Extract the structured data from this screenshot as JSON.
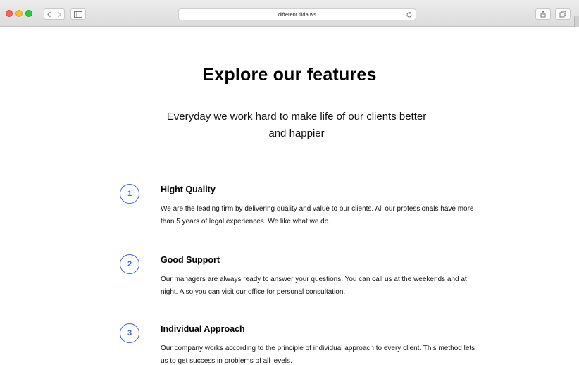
{
  "browser": {
    "url": "different.tilda.ws"
  },
  "page": {
    "title": "Explore our features",
    "subtitle": "Everyday we work hard to make life of our clients better and happier"
  },
  "features": [
    {
      "number": "1",
      "title": "Hight Quality",
      "description": "We are the leading firm by delivering quality and value to our clients. All our professionals have more than 5 years of legal experiences. We like what we do."
    },
    {
      "number": "2",
      "title": "Good Support",
      "description": "Our managers are always ready to answer your questions. You can call us at the weekends and at night. Also you can visit our office for personal consultation."
    },
    {
      "number": "3",
      "title": "Individual Approach",
      "description": "Our company works according to the principle of individual approach to every client. This method lets us to get success in problems of all levels."
    }
  ],
  "colors": {
    "accent": "#3b64f0"
  }
}
